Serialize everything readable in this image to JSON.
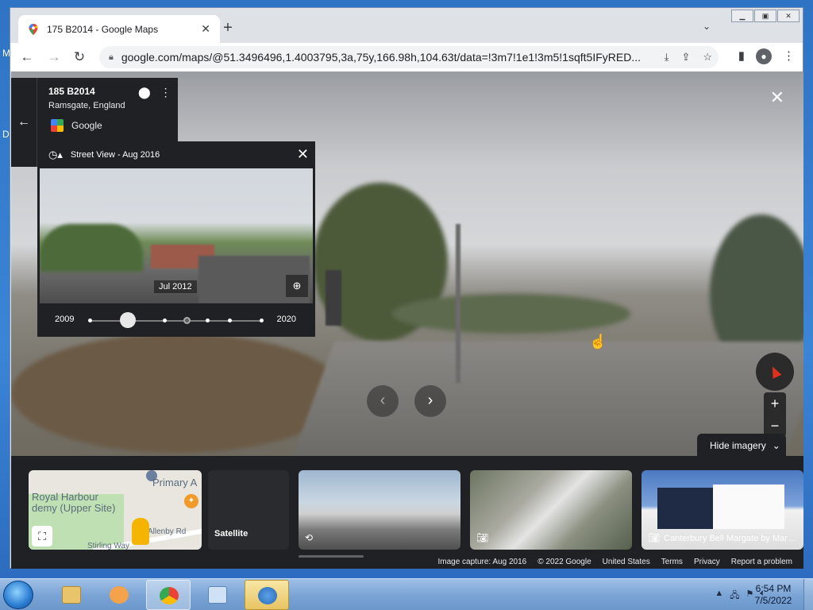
{
  "desktop": {
    "side_letters": [
      "M",
      "D"
    ]
  },
  "browser": {
    "tab_title": "175 B2014 - Google Maps",
    "url": "google.com/maps/@51.3496496,1.4003795,3a,75y,166.98h,104.63t/data=!3m7!1e1!3m5!1sqft5IFyRED...",
    "new_tab": "+",
    "close_glyph": "✕"
  },
  "address_card": {
    "title": "185 B2014",
    "subtitle": "Ramsgate, England",
    "brand": "Google"
  },
  "time_machine": {
    "header": "Street View - Aug 2016",
    "preview_date": "Jul 2012",
    "range_start": "2009",
    "range_end": "2020"
  },
  "controls": {
    "hide_imagery": "Hide imagery",
    "zoom_in": "+",
    "zoom_out": "−"
  },
  "thumbnails": {
    "map_labels": [
      "Royal Harbour",
      "demy (Upper Site)",
      "Primary A",
      "Allenby Rd",
      "Stirling Way"
    ],
    "satellite_label": "Satellite",
    "place_label": "Canterbury Bell Margate by Mars..."
  },
  "footer": {
    "items": [
      "Image capture: Aug 2016",
      "© 2022 Google",
      "United States",
      "Terms",
      "Privacy",
      "Report a problem"
    ]
  },
  "taskbar": {
    "time": "6:54 PM",
    "date": "7/5/2022"
  },
  "colors": {
    "maps_dark": "#202124",
    "accent_red": "#e0301e",
    "taskbar": "#7ca5d6"
  }
}
